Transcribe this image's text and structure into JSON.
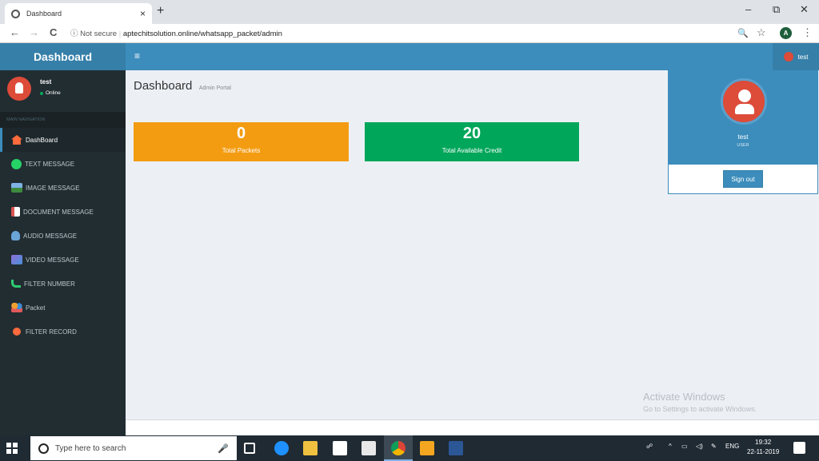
{
  "browser": {
    "tab_title": "Dashboard",
    "new_tab": "+",
    "win_min": "–",
    "win_max": "⧉",
    "win_close": "✕",
    "tab_close": "×",
    "back": "←",
    "forward": "→",
    "reload": "C",
    "info": "ⓘ",
    "not_secure": "Not secure",
    "url": "aptechitsolution.online/whatsapp_packet/admin",
    "zoom_icon": "🔍",
    "star_icon": "☆",
    "profile_initial": "A",
    "menu_icon": "⋮"
  },
  "app": {
    "logo": "Dashboard",
    "hamburger": "≡",
    "topbar_user": "test",
    "sidebar": {
      "user_name": "test",
      "user_status": "Online",
      "nav_header": "MAIN NAVIGATION",
      "items": [
        {
          "label": "DashBoard",
          "icon": "home-icon",
          "color": "#ff6b3d"
        },
        {
          "label": "TEXT MESSAGE",
          "icon": "whatsapp-icon",
          "color": "#25d366"
        },
        {
          "label": "IMAGE MESSAGE",
          "icon": "image-icon",
          "color": "#4a90d9"
        },
        {
          "label": "DOCUMENT MESSAGE",
          "icon": "pdf-icon",
          "color": "#d9534f"
        },
        {
          "label": "AUDIO MESSAGE",
          "icon": "audio-icon",
          "color": "#6aa5d8"
        },
        {
          "label": "VIDEO MESSAGE",
          "icon": "video-icon",
          "color": "#8e6fd8"
        },
        {
          "label": "FILTER NUMBER",
          "icon": "phone-icon",
          "color": "#2ecc71"
        },
        {
          "label": "Packet",
          "icon": "people-icon",
          "color": "#f0a030"
        },
        {
          "label": "FILTER RECORD",
          "icon": "record-icon",
          "color": "#ff6b3d"
        }
      ]
    },
    "header": {
      "title": "Dashboard",
      "subtitle": "Admin Portal"
    },
    "boxes": [
      {
        "value": "0",
        "label": "Total Packets",
        "color": "#f39c12"
      },
      {
        "value": "20",
        "label": "Total Available Credit",
        "color": "#00a65a"
      }
    ],
    "user_dropdown": {
      "name": "test",
      "role": "USER",
      "sign_out": "Sign out"
    },
    "watermark": {
      "line1": "Activate Windows",
      "line2": "Go to Settings to activate Windows."
    }
  },
  "taskbar": {
    "search_placeholder": "Type here to search",
    "time": "19:32",
    "date": "22-11-2019",
    "language": "ENG"
  }
}
